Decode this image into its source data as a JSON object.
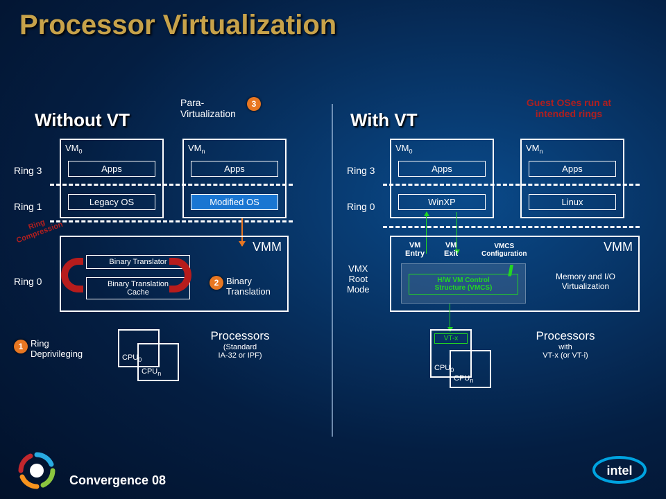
{
  "title": "Processor Virtualization",
  "left": {
    "heading": "Without VT",
    "para_label": "Para-\nVirtualization",
    "ring3": "Ring 3",
    "ring1": "Ring 1",
    "ring0": "Ring 0",
    "ring_compression": "Ring\nCompression",
    "vm0": "VM",
    "vm0_sub": "0",
    "vmn": "VM",
    "vmn_sub": "n",
    "apps": "Apps",
    "legacy_os": "Legacy OS",
    "modified_os": "Modified OS",
    "vmm": "VMM",
    "bt": "Binary Translator",
    "btc": "Binary Translation\nCache",
    "bt_label": "Binary\nTranslation",
    "ring_depriv": "Ring\nDeprivileging",
    "cpu0": "CPU",
    "cpu0_sub": "0",
    "cpun": "CPU",
    "cpun_sub": "n",
    "proc": "Processors",
    "proc_sub": "(Standard\nIA-32 or IPF)",
    "n1": "1",
    "n2": "2",
    "n3": "3"
  },
  "right": {
    "heading": "With VT",
    "note": "Guest OSes run at\nintended rings",
    "ring3": "Ring 3",
    "ring0": "Ring 0",
    "vmx": "VMX\nRoot\nMode",
    "vm0": "VM",
    "vm0_sub": "0",
    "vmn": "VM",
    "vmn_sub": "n",
    "apps": "Apps",
    "winxp": "WinXP",
    "linux": "Linux",
    "vmm": "VMM",
    "vm_entry": "VM\nEntry",
    "vm_exit": "VM\nExit",
    "vmcs_cfg": "VMCS\nConfiguration",
    "vmcs": "H/W VM Control\nStructure (VMCS)",
    "memio": "Memory and I/O\nVirtualization",
    "vtx": "VT-x",
    "cpu0": "CPU",
    "cpu0_sub": "0",
    "cpun": "CPU",
    "cpun_sub": "n",
    "proc": "Processors",
    "proc_sub": "with\nVT-x (or VT-i)"
  },
  "footer": "Convergence 08",
  "intel": "intel"
}
